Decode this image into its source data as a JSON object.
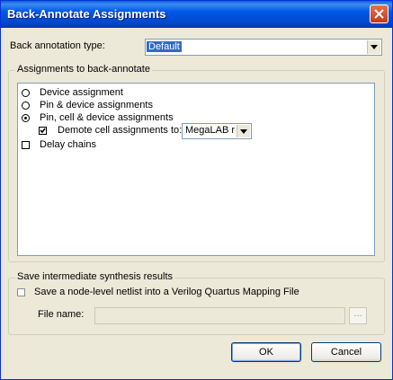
{
  "window": {
    "title": "Back-Annotate Assignments"
  },
  "back_annotation": {
    "label": "Back annotation type:",
    "selected": "Default"
  },
  "assignments_group": {
    "title": "Assignments to back-annotate",
    "options": [
      {
        "label": "Device assignment",
        "selected": false
      },
      {
        "label": "Pin & device assignments",
        "selected": false
      },
      {
        "label": "Pin, cell & device assignments",
        "selected": true
      }
    ],
    "demote": {
      "label": "Demote cell assignments to:",
      "checked": true,
      "value": "MegaLAB r"
    },
    "delay_chains": {
      "label": "Delay chains",
      "checked": false
    }
  },
  "synthesis_group": {
    "title": "Save intermediate synthesis results",
    "checkbox_label": "Save a node-level netlist into a Verilog Quartus Mapping File",
    "file_name_label": "File name:",
    "file_name_value": "",
    "browse_label": "..."
  },
  "buttons": {
    "ok": "OK",
    "cancel": "Cancel"
  }
}
